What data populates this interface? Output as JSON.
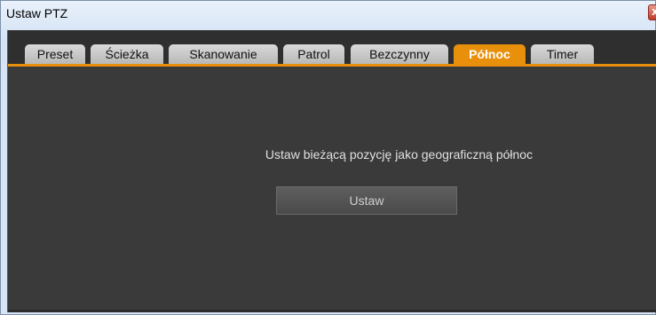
{
  "window": {
    "title": "Ustaw PTZ",
    "close_icon": "close-icon",
    "close_glyph": "x"
  },
  "tabs": [
    {
      "label": "Preset",
      "active": false
    },
    {
      "label": "Ścieżka",
      "active": false
    },
    {
      "label": "Skanowanie",
      "active": false
    },
    {
      "label": "Patrol",
      "active": false
    },
    {
      "label": "Bezczynny",
      "active": false
    },
    {
      "label": "Północ",
      "active": true
    },
    {
      "label": "Timer",
      "active": false
    }
  ],
  "north_panel": {
    "message": "Ustaw bieżącą pozycję jako geograficzną północ",
    "set_button_label": "Ustaw"
  },
  "colors": {
    "accent": "#e8900c",
    "panel_bg": "#3a3a3a"
  }
}
